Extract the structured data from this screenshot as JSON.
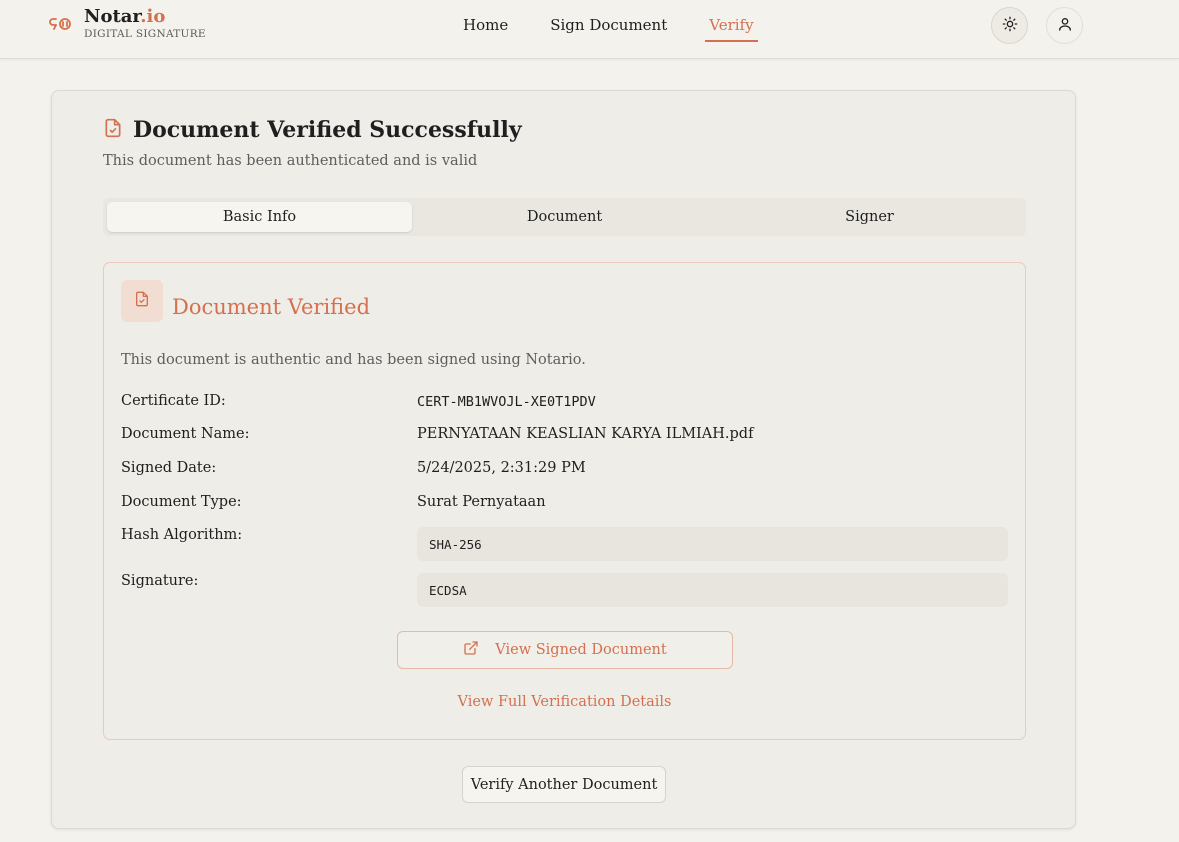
{
  "app": {
    "name_primary": "Notar",
    "name_accent": ".io",
    "subtitle": "DIGITAL SIGNATURE"
  },
  "nav": {
    "items": [
      {
        "label": "Home"
      },
      {
        "label": "Sign Document"
      },
      {
        "label": "Verify",
        "active": true
      }
    ]
  },
  "header_icons": [
    "sun-icon",
    "user-icon"
  ],
  "card": {
    "title": "Document Verified Successfully",
    "description": "This document has been authenticated and is valid",
    "tabs": [
      {
        "label": "Basic Info",
        "active": true
      },
      {
        "label": "Document"
      },
      {
        "label": "Signer"
      }
    ]
  },
  "verified": {
    "title": "Document Verified",
    "description": "This document is authentic and has been signed using Notario.",
    "fields": {
      "certificate_id": {
        "label": "Certificate ID:",
        "value": "CERT-MB1WVOJL-XE0T1PDV"
      },
      "document_name": {
        "label": "Document Name:",
        "value": "PERNYATAAN KEASLIAN KARYA ILMIAH.pdf"
      },
      "signed_date": {
        "label": "Signed Date:",
        "value": "5/24/2025, 2:31:29 PM"
      },
      "document_type": {
        "label": "Document Type:",
        "value": "Surat Pernyataan"
      },
      "hash_algorithm": {
        "label": "Hash Algorithm:",
        "value": "SHA-256"
      },
      "signature": {
        "label": "Signature:",
        "value": "ECDSA"
      }
    },
    "view_button": "View Signed Document",
    "details_link": "View Full Verification Details"
  },
  "another_button": "Verify Another Document",
  "colors": {
    "accent": "#d4704f",
    "background": "#f4f2ec",
    "card": "#efede7"
  }
}
